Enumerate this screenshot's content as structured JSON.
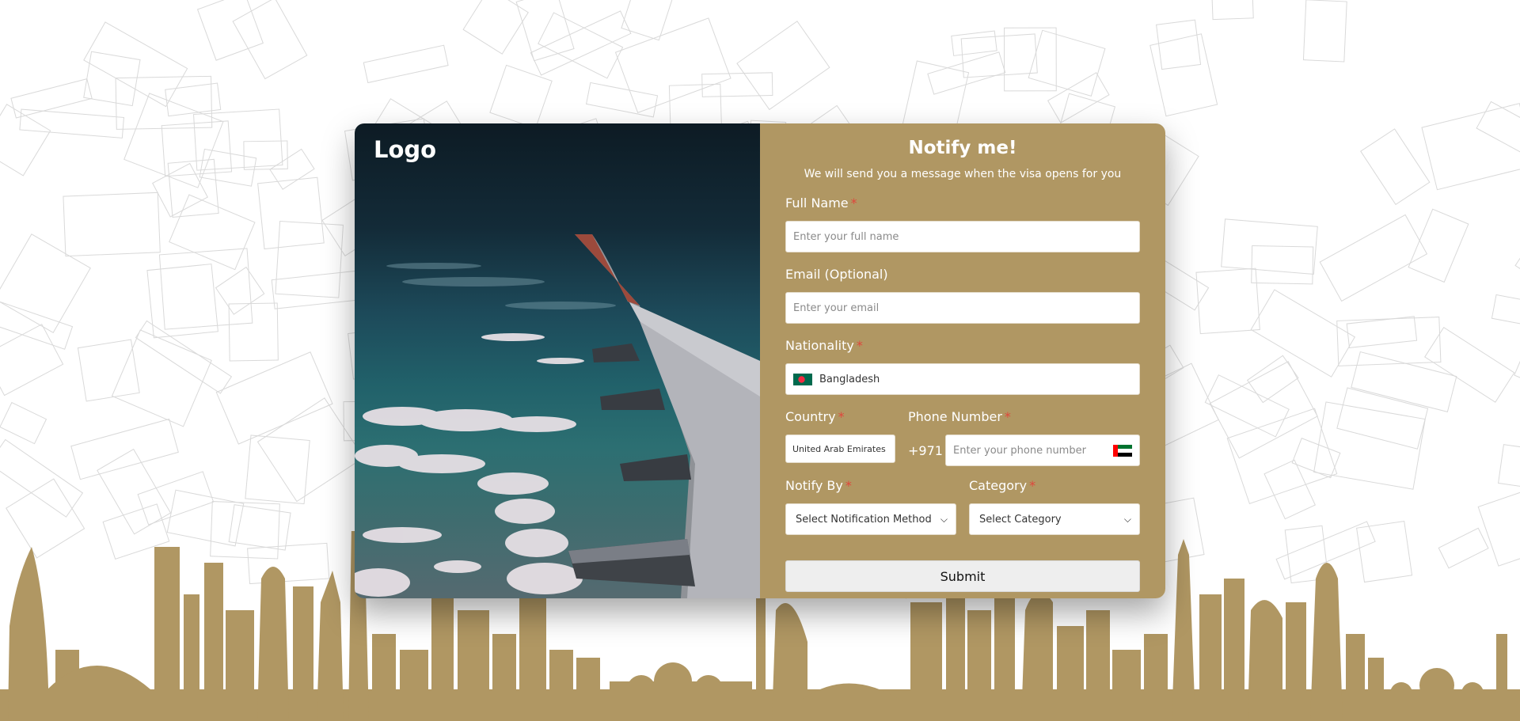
{
  "brand": {
    "logo_text": "Logo"
  },
  "form": {
    "title": "Notify me!",
    "subtitle": "We will send you a message when the visa opens for you",
    "required_mark": "*",
    "full_name": {
      "label": "Full Name",
      "placeholder": "Enter your full name"
    },
    "email": {
      "label": "Email (Optional)",
      "placeholder": "Enter your email"
    },
    "nationality": {
      "label": "Nationality",
      "value": "Bangladesh"
    },
    "country": {
      "label": "Country",
      "value": "United Arab Emirates"
    },
    "phone": {
      "label": "Phone Number",
      "dial_code": "+971",
      "placeholder": "Enter your phone number"
    },
    "notify_by": {
      "label": "Notify By",
      "selected": "Select Notification Method"
    },
    "category": {
      "label": "Category",
      "selected": "Select Category"
    },
    "submit_label": "Submit"
  },
  "colors": {
    "gold": "#b09763",
    "required": "#e0463c",
    "pattern_line": "#d9d9d9"
  },
  "icons": {
    "nationality_flag": "bangladesh-flag-icon",
    "phone_flag": "uae-flag-icon",
    "dropdown": "chevron-down-icon"
  }
}
